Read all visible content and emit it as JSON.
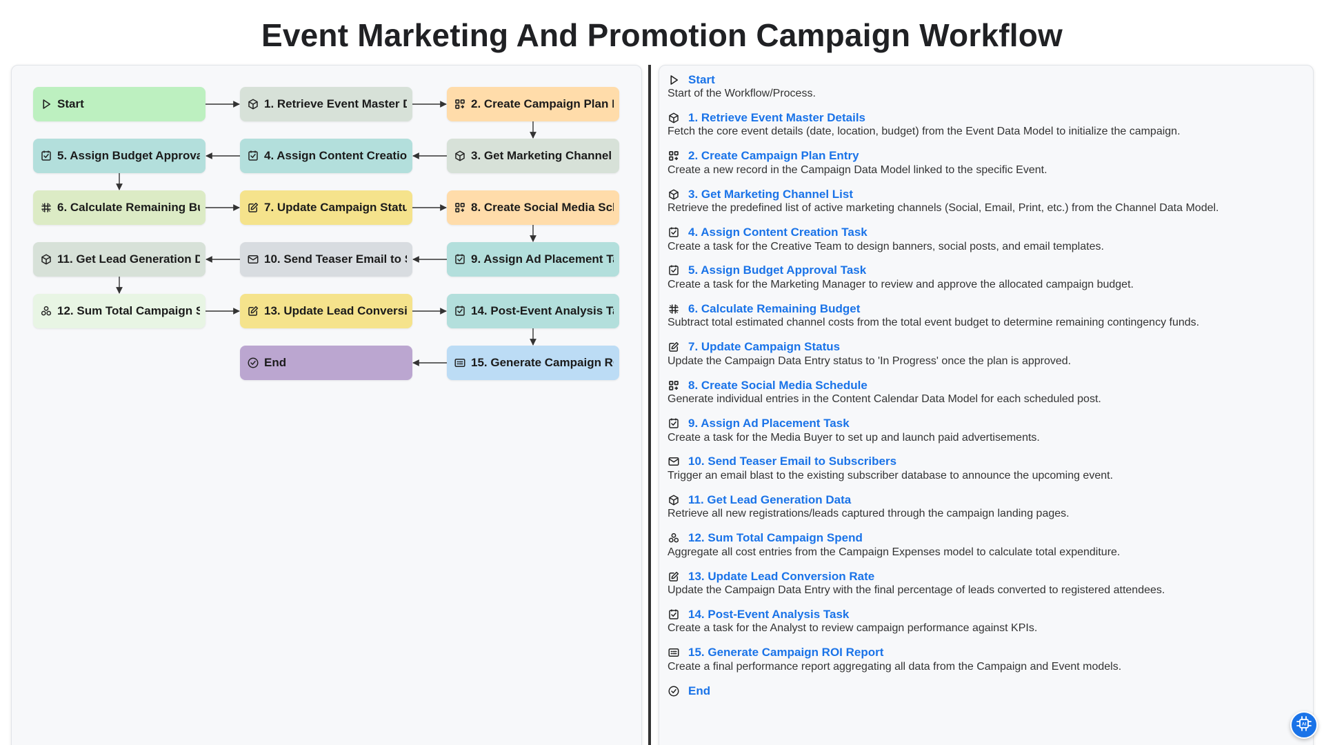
{
  "page": {
    "title": "Event Marketing And Promotion Campaign Workflow"
  },
  "colors": {
    "green": "#bdf0c0",
    "sage": "#d7e1d8",
    "orange": "#ffdcaa",
    "teal": "#b3dfdc",
    "lime": "#dcebc5",
    "yellow": "#f5e38c",
    "gray": "#d8dce0",
    "mint": "#e8f5e4",
    "purple": "#bba6d0",
    "blue": "#bcdcf5",
    "link": "#1a73e8"
  },
  "nodes": [
    {
      "id": "start",
      "label": "Start",
      "icon": "play-icon",
      "color": "green",
      "col": 0,
      "row": 0
    },
    {
      "id": "n1",
      "label": "1. Retrieve Event Master Details",
      "icon": "cube-icon",
      "color": "sage",
      "col": 1,
      "row": 0
    },
    {
      "id": "n2",
      "label": "2. Create Campaign Plan Entry",
      "icon": "grid-plus-icon",
      "color": "orange",
      "col": 2,
      "row": 0
    },
    {
      "id": "n3",
      "label": "3. Get Marketing Channel List",
      "icon": "cube-icon",
      "color": "sage",
      "col": 2,
      "row": 1
    },
    {
      "id": "n4",
      "label": "4. Assign Content Creation Task",
      "icon": "checkbox-icon",
      "color": "teal",
      "col": 1,
      "row": 1
    },
    {
      "id": "n5",
      "label": "5. Assign Budget Approval Task",
      "icon": "checkbox-icon",
      "color": "teal",
      "col": 0,
      "row": 1
    },
    {
      "id": "n6",
      "label": "6. Calculate Remaining Budget",
      "icon": "hash-icon",
      "color": "lime",
      "col": 0,
      "row": 2
    },
    {
      "id": "n7",
      "label": "7. Update Campaign Status",
      "icon": "edit-icon",
      "color": "yellow",
      "col": 1,
      "row": 2
    },
    {
      "id": "n8",
      "label": "8. Create Social Media Schedule",
      "icon": "grid-plus-icon",
      "color": "orange",
      "col": 2,
      "row": 2
    },
    {
      "id": "n9",
      "label": "9. Assign Ad Placement Task",
      "icon": "checkbox-icon",
      "color": "teal",
      "col": 2,
      "row": 3
    },
    {
      "id": "n10",
      "label": "10. Send Teaser Email to Subscribers",
      "icon": "mail-icon",
      "color": "gray",
      "col": 1,
      "row": 3
    },
    {
      "id": "n11",
      "label": "11. Get Lead Generation Data",
      "icon": "cube-icon",
      "color": "sage",
      "col": 0,
      "row": 3
    },
    {
      "id": "n12",
      "label": "12. Sum Total Campaign Spend",
      "icon": "cluster-icon",
      "color": "mint",
      "col": 0,
      "row": 4
    },
    {
      "id": "n13",
      "label": "13. Update Lead Conversion Rate",
      "icon": "edit-icon",
      "color": "yellow",
      "col": 1,
      "row": 4
    },
    {
      "id": "n14",
      "label": "14. Post-Event Analysis Task",
      "icon": "checkbox-icon",
      "color": "teal",
      "col": 2,
      "row": 4
    },
    {
      "id": "n15",
      "label": "15. Generate Campaign ROI Report",
      "icon": "report-icon",
      "color": "blue",
      "col": 2,
      "row": 5
    },
    {
      "id": "end",
      "label": "End",
      "icon": "check-circle-icon",
      "color": "purple",
      "col": 1,
      "row": 5
    }
  ],
  "steps": [
    {
      "title": "Start",
      "icon": "play-icon",
      "desc": "Start of the Workflow/Process."
    },
    {
      "title": "1. Retrieve Event Master Details",
      "icon": "cube-icon",
      "desc": "Fetch the core event details (date, location, budget) from the Event Data Model to initialize the campaign."
    },
    {
      "title": "2. Create Campaign Plan Entry",
      "icon": "grid-plus-icon",
      "desc": "Create a new record in the Campaign Data Model linked to the specific Event."
    },
    {
      "title": "3. Get Marketing Channel List",
      "icon": "cube-icon",
      "desc": "Retrieve the predefined list of active marketing channels (Social, Email, Print, etc.) from the Channel Data Model."
    },
    {
      "title": "4. Assign Content Creation Task",
      "icon": "checkbox-icon",
      "desc": "Create a task for the Creative Team to design banners, social posts, and email templates."
    },
    {
      "title": "5. Assign Budget Approval Task",
      "icon": "checkbox-icon",
      "desc": "Create a task for the Marketing Manager to review and approve the allocated campaign budget."
    },
    {
      "title": "6. Calculate Remaining Budget",
      "icon": "hash-icon",
      "desc": "Subtract total estimated channel costs from the total event budget to determine remaining contingency funds."
    },
    {
      "title": "7. Update Campaign Status",
      "icon": "edit-icon",
      "desc": "Update the Campaign Data Entry status to 'In Progress' once the plan is approved."
    },
    {
      "title": "8. Create Social Media Schedule",
      "icon": "grid-plus-icon",
      "desc": "Generate individual entries in the Content Calendar Data Model for each scheduled post."
    },
    {
      "title": "9. Assign Ad Placement Task",
      "icon": "checkbox-icon",
      "desc": "Create a task for the Media Buyer to set up and launch paid advertisements."
    },
    {
      "title": "10. Send Teaser Email to Subscribers",
      "icon": "mail-icon",
      "desc": "Trigger an email blast to the existing subscriber database to announce the upcoming event."
    },
    {
      "title": "11. Get Lead Generation Data",
      "icon": "cube-icon",
      "desc": "Retrieve all new registrations/leads captured through the campaign landing pages."
    },
    {
      "title": "12. Sum Total Campaign Spend",
      "icon": "cluster-icon",
      "desc": "Aggregate all cost entries from the Campaign Expenses model to calculate total expenditure."
    },
    {
      "title": "13. Update Lead Conversion Rate",
      "icon": "edit-icon",
      "desc": "Update the Campaign Data Entry with the final percentage of leads converted to registered attendees."
    },
    {
      "title": "14. Post-Event Analysis Task",
      "icon": "checkbox-icon",
      "desc": "Create a task for the Analyst to review campaign performance against KPIs."
    },
    {
      "title": "15. Generate Campaign ROI Report",
      "icon": "report-icon",
      "desc": "Create a final performance report aggregating all data from the Campaign and Event models."
    },
    {
      "title": "End",
      "icon": "check-circle-icon",
      "desc": ""
    }
  ],
  "float_button": {
    "icon": "ai-chip-icon"
  }
}
